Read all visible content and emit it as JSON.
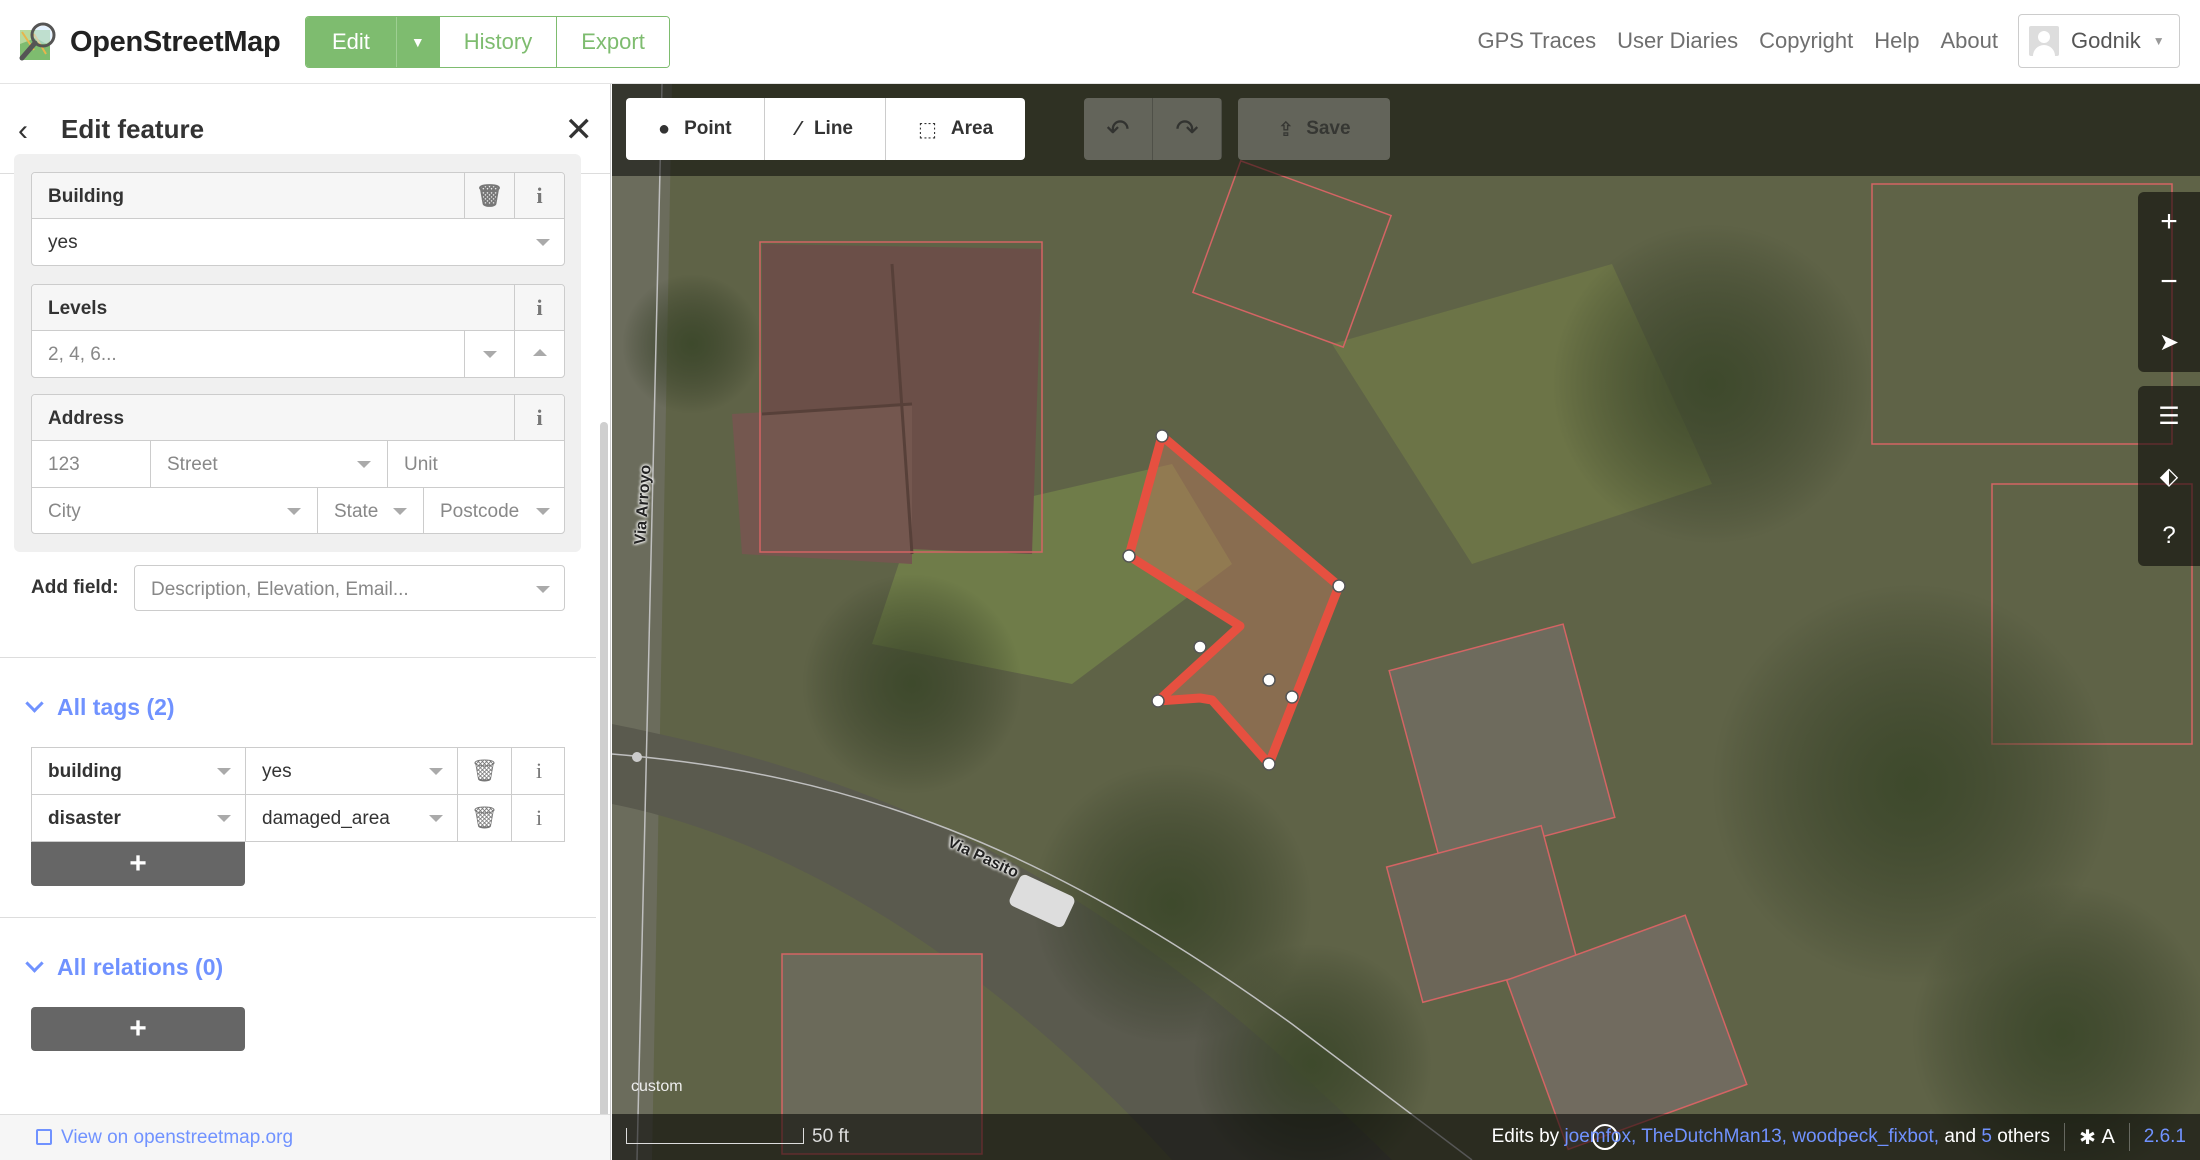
{
  "navbar": {
    "brand": "OpenStreetMap",
    "edit_label": "Edit",
    "history_label": "History",
    "export_label": "Export",
    "links": [
      "GPS Traces",
      "User Diaries",
      "Copyright",
      "Help",
      "About"
    ],
    "user_name": "Godnik"
  },
  "sidebar": {
    "title": "Edit feature",
    "fields": {
      "building": {
        "label": "Building",
        "value": "yes"
      },
      "levels": {
        "label": "Levels",
        "placeholder": "2, 4, 6..."
      },
      "address": {
        "label": "Address",
        "housenumber_placeholder": "123",
        "street_placeholder": "Street",
        "unit_placeholder": "Unit",
        "city_placeholder": "City",
        "state_placeholder": "State",
        "postcode_placeholder": "Postcode"
      }
    },
    "add_field": {
      "label": "Add field:",
      "placeholder": "Description, Elevation, Email..."
    },
    "all_tags": {
      "title": "All tags (2)",
      "rows": [
        {
          "key": "building",
          "value": "yes"
        },
        {
          "key": "disaster",
          "value": "damaged_area"
        }
      ],
      "add_label": "+"
    },
    "all_relations": {
      "title": "All relations (0)",
      "add_label": "+"
    },
    "footer_link": "View on openstreetmap.org"
  },
  "map": {
    "modes": [
      {
        "label": "Point",
        "icon": "point-icon"
      },
      {
        "label": "Line",
        "icon": "line-icon"
      },
      {
        "label": "Area",
        "icon": "area-icon"
      }
    ],
    "save_label": "Save",
    "road_labels": {
      "via_arroyo": "Via Arroyo",
      "via_pasito": "Via Pasito"
    },
    "imagery_label": "custom",
    "scale_label": "50 ft",
    "attribution": {
      "prefix": "Edits by",
      "user1": "joemfox,",
      "user2": "TheDutchMan13,",
      "user3": "woodpeck_fixbot,",
      "and": "and",
      "others_count": "5",
      "others": "others"
    },
    "version": "2.6.1",
    "colors": {
      "selected_area": "#e65040",
      "accent": "#7092ff",
      "brand_green": "#7ebc6f"
    }
  }
}
